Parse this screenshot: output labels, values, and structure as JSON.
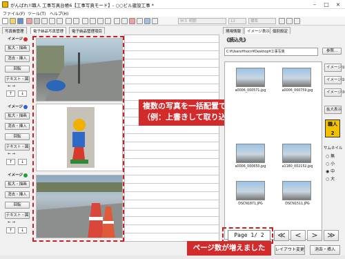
{
  "window": {
    "title": "がんばれ!!職人 工事写真台帳6【工事写真モード】- ○○ビル建設工事 *"
  },
  "menu": [
    {
      "label": "ファイル(F)"
    },
    {
      "label": "ツール(T)"
    },
    {
      "label": "ヘルプ(H)"
    }
  ],
  "toolbar": {
    "font": "ＭＳ 明朝",
    "size": "12",
    "style": "標準"
  },
  "tabs": {
    "left": "写真帳管理",
    "mid1": "電子納品写真管理",
    "mid2": "電子納品管理項目",
    "right1": "現場情報",
    "right2": "イメージ表示",
    "right3": "個別設定"
  },
  "left": {
    "image1": "イメージ",
    "image2": "イメージ",
    "image3": "イメージ",
    "zoom": "拡大・描画",
    "delete_insert": "消去・挿入",
    "rotate": "回転",
    "text_draw": "テキスト・図",
    "arrows": "← →",
    "up": "↑",
    "down": "↓"
  },
  "right": {
    "read_dest": "《読込先》",
    "path": "C:¥Users¥hocn¥Desktop¥工事写真",
    "browse": "参照...",
    "thumbs": [
      {
        "name": "a0006_000571.jpg"
      },
      {
        "name": "a0006_000759.jpg"
      },
      {
        "name": "a0006_000650.jpg"
      },
      {
        "name": "a1180_002152.jpg"
      },
      {
        "name": "DSCN1871.JPG"
      },
      {
        "name": "DSCN1511.JPG"
      }
    ],
    "img1": "イメージ①",
    "img2": "イメージ②",
    "img3": "イメージ③",
    "zoom_view": "拡大表示",
    "badge": "職人",
    "thumb_size": "サムネイル",
    "size_none": "無",
    "size_small": "小",
    "size_mid": "中",
    "size_large": "大",
    "page": "Page  1/ 2",
    "layout_change": "レイアウト変更",
    "delete_insert": "消去・挿入",
    "nav_first": "≪",
    "nav_prev": "<",
    "nav_next": ">",
    "nav_last": "≫"
  },
  "callouts": {
    "bulk": "複数の写真を一括配置できました\n（例：上書きして取り込み）",
    "pages": "ページ数が増えました"
  },
  "colors": {
    "red": "#d12b2b",
    "blue_dot": "#2a62d6",
    "green_dot": "#1da33a"
  }
}
